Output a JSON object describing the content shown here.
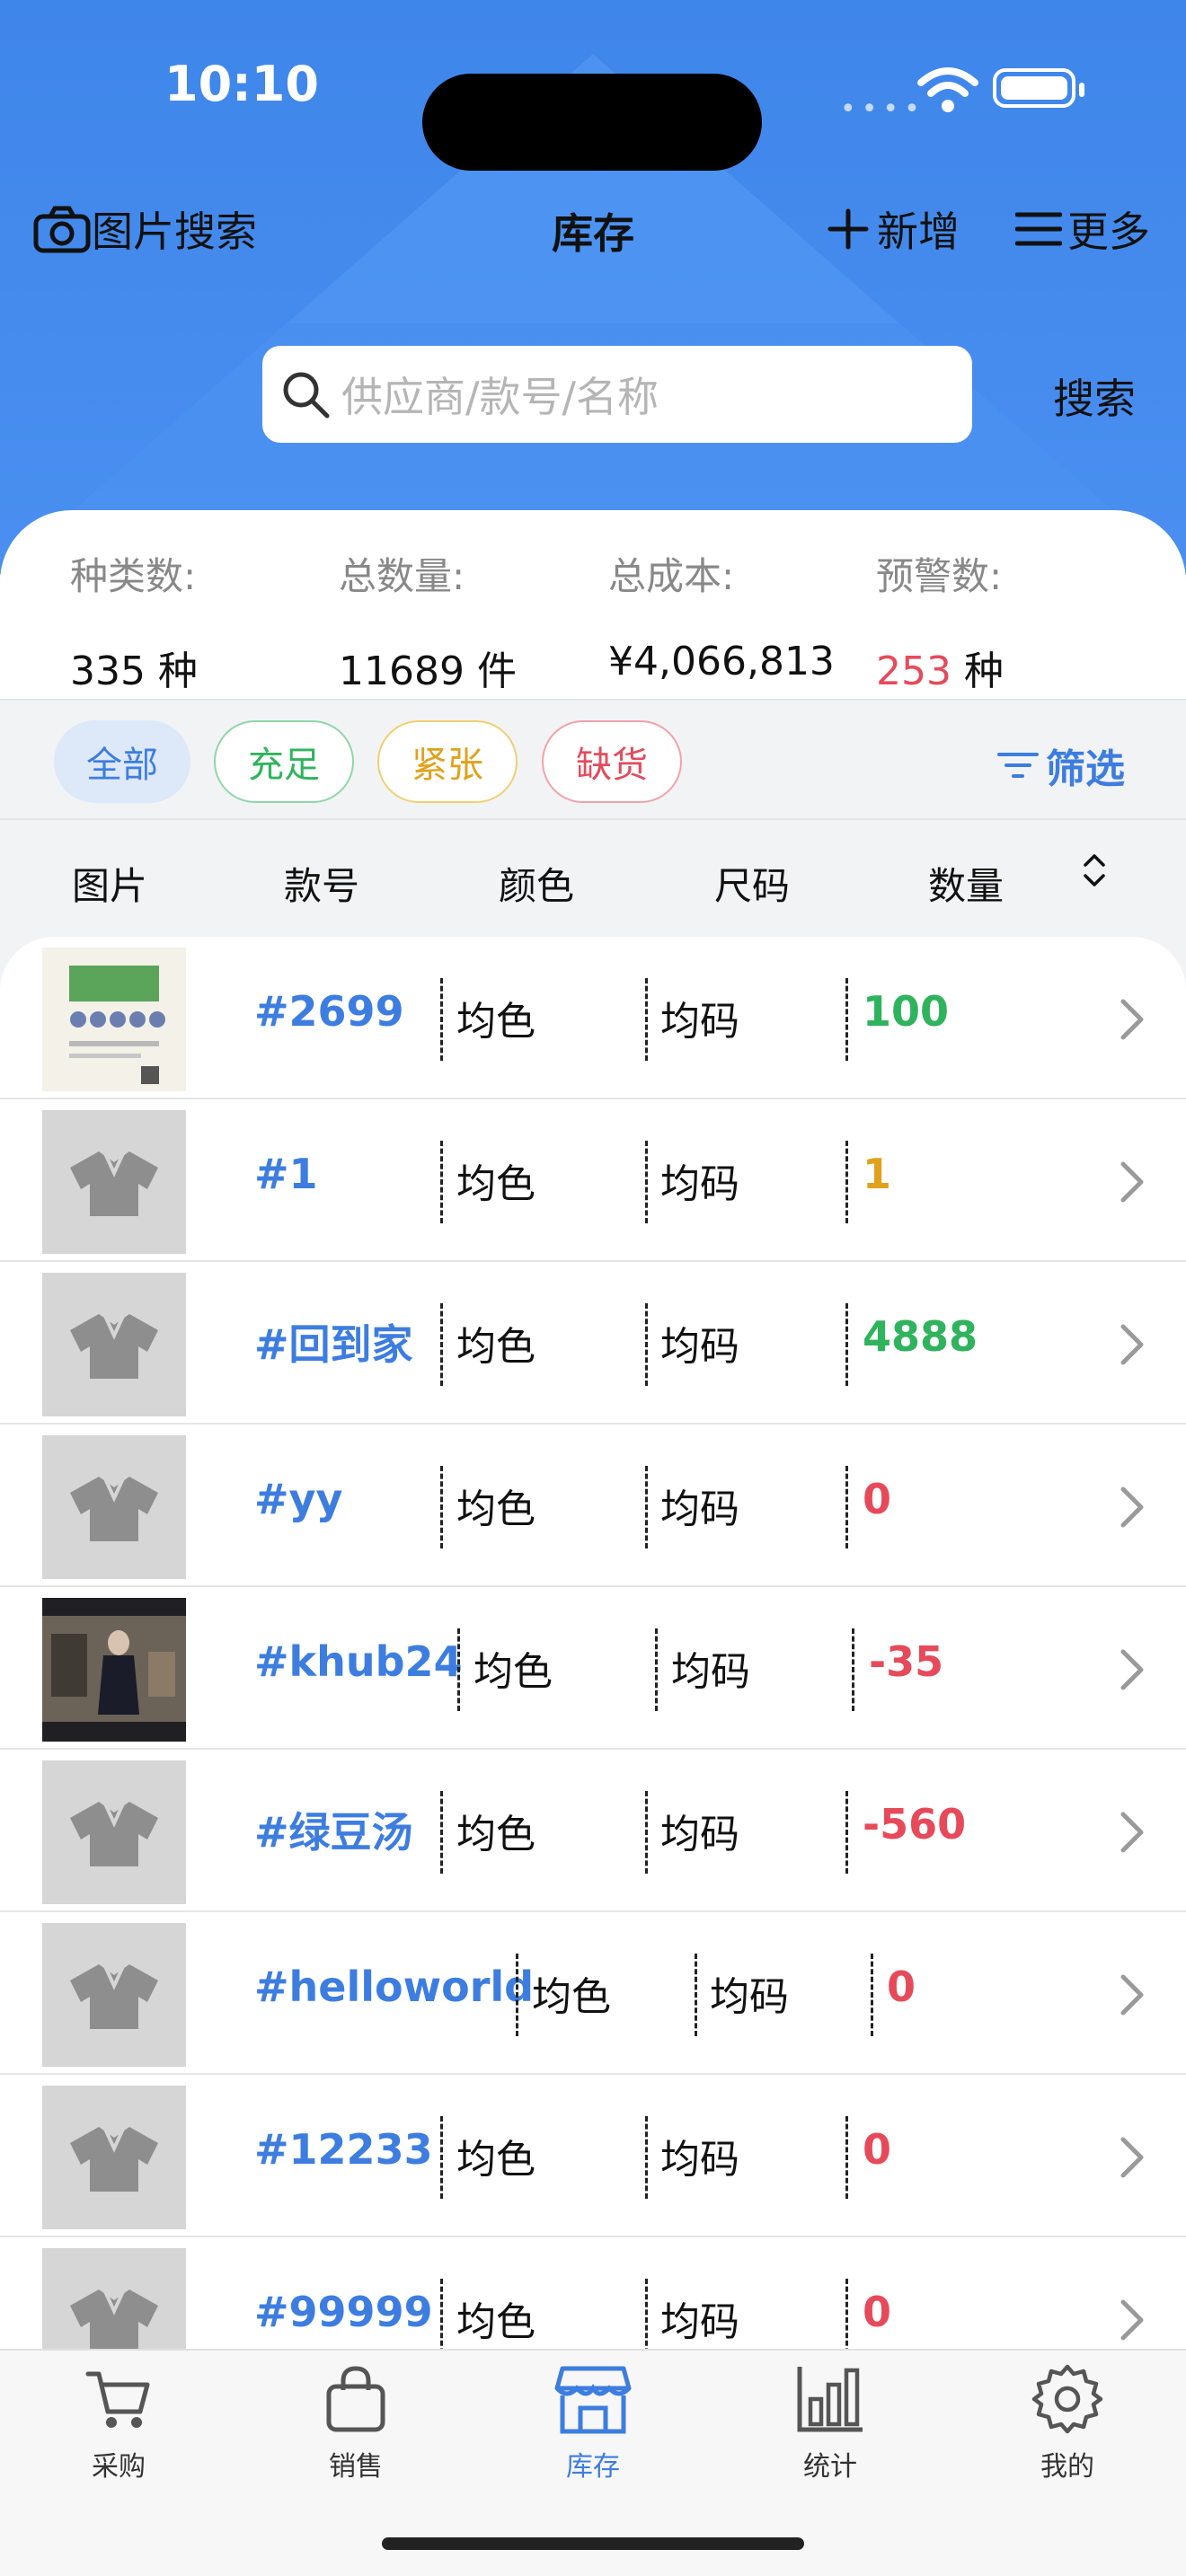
{
  "status": {
    "time": "10:10"
  },
  "header": {
    "image_search": "图片搜索",
    "title": "库存",
    "add": "新增",
    "more": "更多"
  },
  "search": {
    "placeholder": "供应商/款号/名称",
    "button": "搜索"
  },
  "stats": [
    {
      "label": "种类数:",
      "value": "335",
      "unit": "种"
    },
    {
      "label": "总数量:",
      "value": "11689",
      "unit": "件"
    },
    {
      "label": "总成本:",
      "value": "¥4,066,813",
      "unit": ""
    },
    {
      "label": "预警数:",
      "value": "253",
      "unit": "种"
    }
  ],
  "filters": {
    "all": "全部",
    "sufficient": "充足",
    "tight": "紧张",
    "shortage": "缺货",
    "filter": "筛选"
  },
  "columns": {
    "image": "图片",
    "code": "款号",
    "color": "颜色",
    "size": "尺码",
    "quantity": "数量"
  },
  "colors": {
    "accent": "#3d7de0",
    "green": "#2fb35d",
    "yellow": "#e0a21c",
    "red": "#e64a5a"
  },
  "rows": [
    {
      "code": "#2699",
      "color": "均色",
      "size": "均码",
      "qty": "100",
      "status": "green",
      "thumb": "photo"
    },
    {
      "code": "#1",
      "color": "均色",
      "size": "均码",
      "qty": "1",
      "status": "yellow",
      "thumb": "shirt-icon"
    },
    {
      "code": "#回到家",
      "color": "均色",
      "size": "均码",
      "qty": "4888",
      "status": "green",
      "thumb": "shirt-icon"
    },
    {
      "code": "#yy",
      "color": "均色",
      "size": "均码",
      "qty": "0",
      "status": "red",
      "thumb": "shirt-icon"
    },
    {
      "code": "#khub24",
      "color": "均色",
      "size": "均码",
      "qty": "-35",
      "status": "red",
      "thumb": "photo"
    },
    {
      "code": "#绿豆汤",
      "color": "均色",
      "size": "均码",
      "qty": "-560",
      "status": "red",
      "thumb": "shirt-icon"
    },
    {
      "code": "#helloworld",
      "color": "均色",
      "size": "均码",
      "qty": "0",
      "status": "red",
      "thumb": "shirt-icon"
    },
    {
      "code": "#12233",
      "color": "均色",
      "size": "均码",
      "qty": "0",
      "status": "red",
      "thumb": "shirt-icon"
    },
    {
      "code": "#99999",
      "color": "均色",
      "size": "均码",
      "qty": "0",
      "status": "red",
      "thumb": "shirt-icon"
    }
  ],
  "tabs": [
    {
      "label": "采购",
      "icon": "cart-icon"
    },
    {
      "label": "销售",
      "icon": "bag-icon"
    },
    {
      "label": "库存",
      "icon": "store-icon",
      "active": true
    },
    {
      "label": "统计",
      "icon": "bar-chart-icon"
    },
    {
      "label": "我的",
      "icon": "gear-icon"
    }
  ]
}
